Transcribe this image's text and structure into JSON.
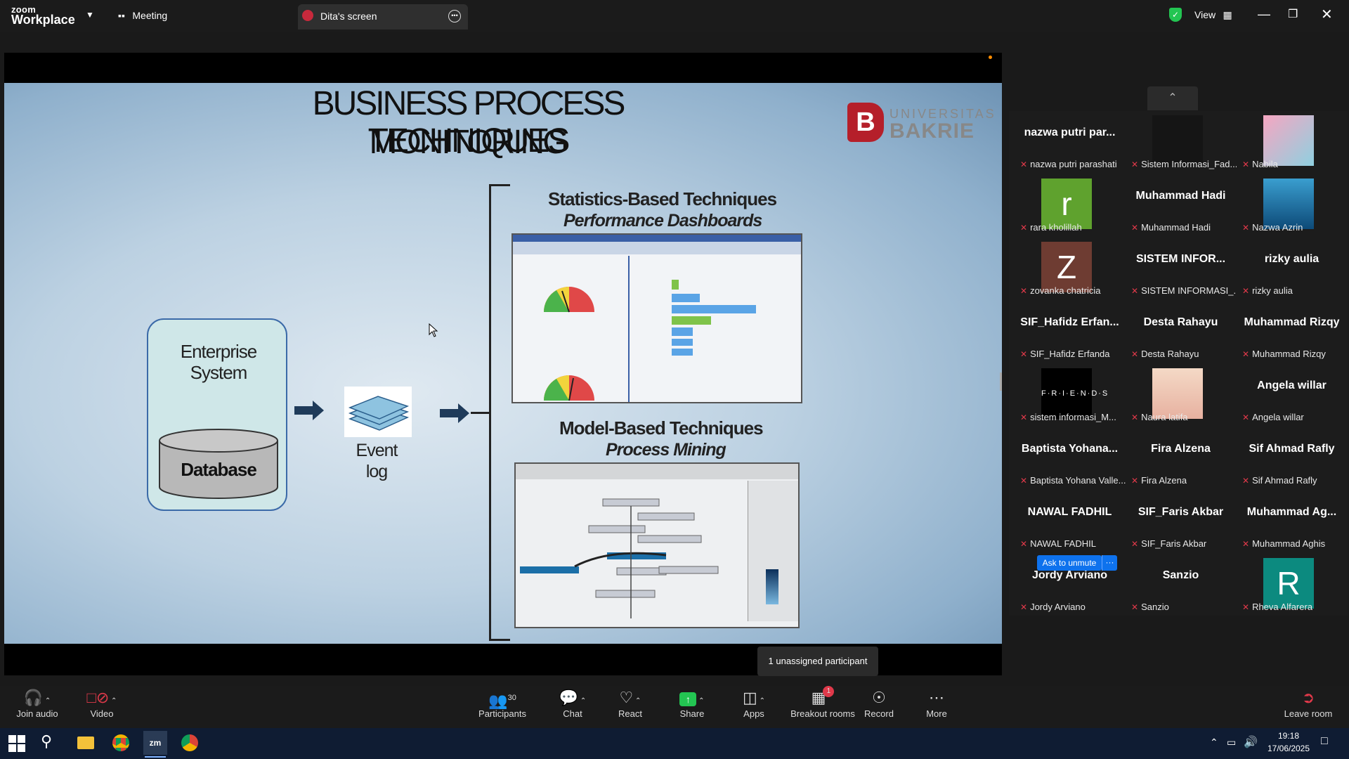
{
  "titlebar": {
    "brand_top": "zoom",
    "brand_bottom": "Workplace",
    "meeting_label": "Meeting",
    "share_tab_label": "Dita's screen",
    "view_label": "View",
    "colors": {
      "accent": "#2d8cff",
      "shield": "#23c552"
    }
  },
  "slide": {
    "title_line1": "BUSINESS PROCESS MONITORING",
    "title_line2": "TECHNIQUES",
    "logo_line1": "UNIVERSITAS",
    "logo_line2": "BAKRIE",
    "enterprise_label": "Enterprise System",
    "database_label": "Database",
    "event_log_label": "Event log",
    "stat_title": "Statistics-Based Techniques",
    "stat_subtitle": "Performance Dashboards",
    "model_title": "Model-Based Techniques",
    "model_subtitle": "Process Mining"
  },
  "participants": [
    {
      "display": "nazwa putri par...",
      "label": "nazwa putri parashati",
      "avatar_type": "name"
    },
    {
      "display": "",
      "label": "Sistem Informasi_Fad...",
      "avatar_type": "dark"
    },
    {
      "display": "",
      "label": "Nabila",
      "avatar_type": "pink-image"
    },
    {
      "display": "r",
      "label": "rara kholillah",
      "avatar_type": "green-letter"
    },
    {
      "display": "Muhammad Hadi",
      "label": "Muhammad Hadi",
      "avatar_type": "name"
    },
    {
      "display": "",
      "label": "Nazwa Azrin",
      "avatar_type": "ocean-image"
    },
    {
      "display": "Z",
      "label": "zovanka chatricia",
      "avatar_type": "brown-letter"
    },
    {
      "display": "SISTEM INFOR...",
      "label": "SISTEM INFORMASI_...",
      "avatar_type": "name"
    },
    {
      "display": "rizky aulia",
      "label": "rizky aulia",
      "avatar_type": "name"
    },
    {
      "display": "SIF_Hafidz Erfan...",
      "label": "SIF_Hafidz Erfanda",
      "avatar_type": "name"
    },
    {
      "display": "Desta Rahayu",
      "label": "Desta Rahayu",
      "avatar_type": "name"
    },
    {
      "display": "Muhammad Rizqy",
      "label": "Muhammad Rizqy",
      "avatar_type": "name"
    },
    {
      "display": "F·R·I·E·N·D·S",
      "label": "sistem informasi_M...",
      "avatar_type": "friends"
    },
    {
      "display": "",
      "label": "Naura latifa",
      "avatar_type": "anime-image"
    },
    {
      "display": "Angela willar",
      "label": "Angela willar",
      "avatar_type": "name"
    },
    {
      "display": "Baptista Yohana...",
      "label": "Baptista Yohana Valle...",
      "avatar_type": "name"
    },
    {
      "display": "Fira Alzena",
      "label": "Fira Alzena",
      "avatar_type": "name"
    },
    {
      "display": "Sif Ahmad Rafly",
      "label": "Sif Ahmad Rafly",
      "avatar_type": "name"
    },
    {
      "display": "NAWAL FADHIL",
      "label": "NAWAL FADHIL",
      "avatar_type": "name"
    },
    {
      "display": "SIF_Faris Akbar",
      "label": "SIF_Faris Akbar",
      "avatar_type": "name"
    },
    {
      "display": "Muhammad Ag...",
      "label": "Muhammad Aghis",
      "avatar_type": "name"
    },
    {
      "display": "Jordy Arviano",
      "label": "Jordy Arviano",
      "avatar_type": "name"
    },
    {
      "display": "Sanzio",
      "label": "Sanzio",
      "avatar_type": "name"
    },
    {
      "display": "R",
      "label": "Rheva Alfarera",
      "avatar_type": "teal-letter"
    }
  ],
  "ask_to_unmute": "Ask to unmute",
  "ask_more": "···",
  "tooltip": "1 unassigned participant",
  "toolbar": {
    "join_audio": "Join audio",
    "video": "Video",
    "participants": "Participants",
    "participant_count": "30",
    "chat": "Chat",
    "react": "React",
    "share": "Share",
    "apps": "Apps",
    "breakout": "Breakout rooms",
    "breakout_badge": "1",
    "record": "Record",
    "more": "More",
    "leave": "Leave room"
  },
  "taskbar": {
    "time": "19:18",
    "date": "17/06/2025"
  }
}
